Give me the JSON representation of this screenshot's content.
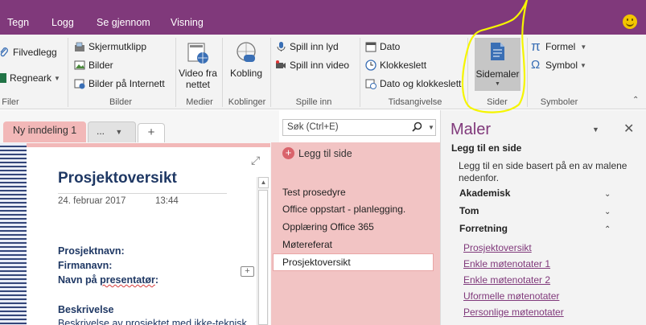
{
  "tabs": [
    "Tegn",
    "Logg",
    "Se gjennom",
    "Visning"
  ],
  "ribbon": {
    "file": {
      "filvedlegg": "Filvedlegg",
      "regneark": "Regneark",
      "label": "Filer"
    },
    "images": {
      "skjermutklipp": "Skjermutklipp",
      "bilder": "Bilder",
      "bilder_internett": "Bilder på Internett",
      "label": "Bilder"
    },
    "media": {
      "video_line1": "Video fra",
      "video_line2": "nettet",
      "label": "Medier"
    },
    "links": {
      "kobling": "Kobling",
      "label": "Koblinger"
    },
    "recording": {
      "lyd": "Spill inn lyd",
      "video": "Spill inn video",
      "label": "Spille inn"
    },
    "time": {
      "dato": "Dato",
      "klokkeslett": "Klokkeslett",
      "dato_klokkeslett": "Dato og klokkeslett",
      "label": "Tidsangivelse"
    },
    "pages": {
      "sidemaler": "Sidemaler",
      "label": "Sider"
    },
    "symbols": {
      "formel": "Formel",
      "symbol": "Symbol",
      "label": "Symboler"
    }
  },
  "notebook": {
    "section_tab": "Ny inndeling 1",
    "more_tabs": "...",
    "add_tab": "+"
  },
  "page": {
    "title": "Prosjektoversikt",
    "date": "24. februar 2017",
    "time": "13:44",
    "fields": [
      "Prosjektnavn:",
      "Firmanavn:"
    ],
    "presenter_prefix": "Navn på ",
    "presenter_word": "presentatør",
    "presenter_suffix": ":",
    "section_heading": "Beskrivelse",
    "section_text": "Beskrivelse av prosjektet med ikke-teknisk"
  },
  "search": {
    "placeholder": "Søk (Ctrl+E)"
  },
  "page_list": {
    "add_page": "Legg til side",
    "items": [
      "Test prosedyre",
      "Office oppstart - planlegging.",
      "Opplæring Office 365",
      "Møtereferat",
      "Prosjektoversikt"
    ],
    "selected": "Prosjektoversikt"
  },
  "templates_pane": {
    "title": "Maler",
    "subtitle": "Legg til en side",
    "description": "Legg til en side basert på en av malene nedenfor.",
    "categories": [
      "Akademisk",
      "Tom",
      "Forretning"
    ],
    "templates": [
      "Prosjektoversikt",
      "Enkle møtenotater 1",
      "Enkle møtenotater 2",
      "Uformelle møtenotater",
      "Personlige møtenotater"
    ]
  },
  "colors": {
    "accent": "#80397b",
    "section_tab": "#f2b8b8",
    "highlight": "#f7f700"
  },
  "icons": [
    "paperclip-icon",
    "spreadsheet-icon",
    "screen-clip-icon",
    "picture-icon",
    "online-picture-icon",
    "online-video-icon",
    "link-icon",
    "microphone-icon",
    "video-record-icon",
    "calendar-icon",
    "clock-icon",
    "datetime-icon",
    "page-template-icon",
    "pi-icon",
    "omega-icon",
    "search-icon",
    "close-icon",
    "smiley-icon"
  ]
}
